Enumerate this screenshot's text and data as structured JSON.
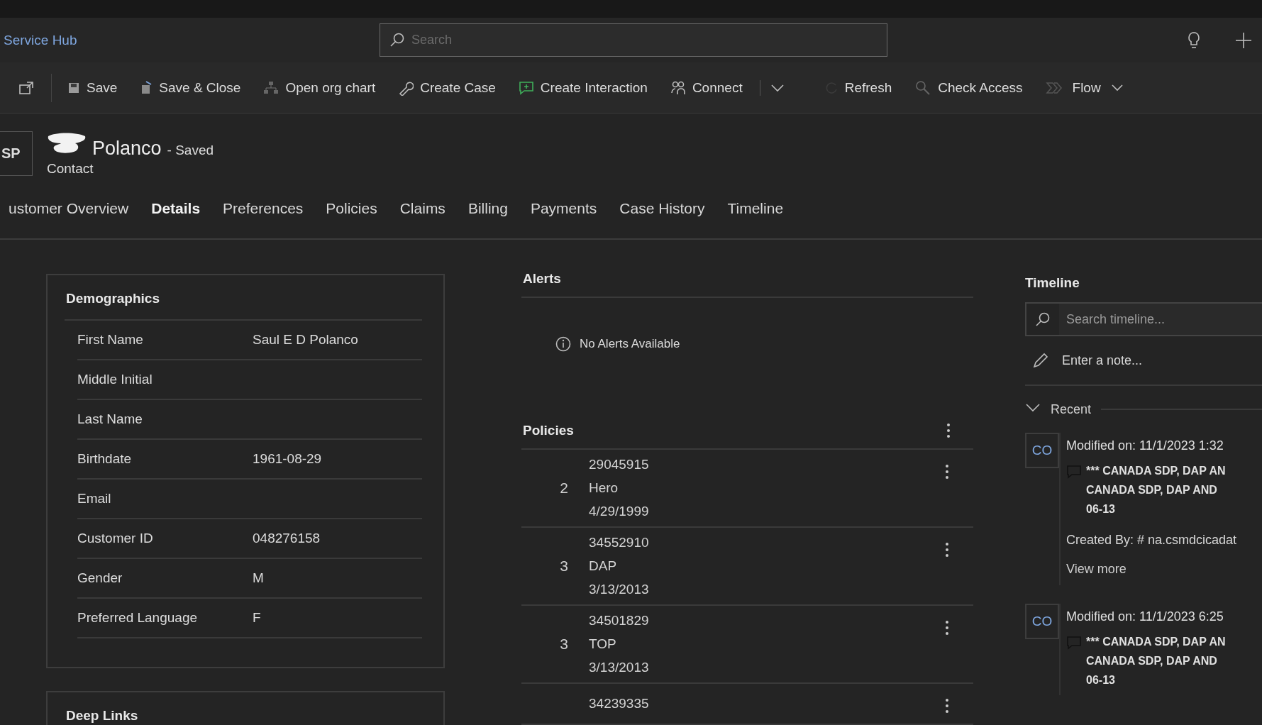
{
  "app": {
    "title": "Service Hub",
    "search_placeholder": "Search"
  },
  "commands": [
    {
      "kind": "icon"
    },
    {
      "kind": "button",
      "label": "Save"
    },
    {
      "kind": "button",
      "label": "Save & Close"
    },
    {
      "kind": "button",
      "label": "Open org chart"
    },
    {
      "kind": "button",
      "label": "Create Case"
    },
    {
      "kind": "button",
      "label": "Create Interaction"
    },
    {
      "kind": "button",
      "label": "Connect"
    },
    {
      "kind": "more"
    },
    {
      "kind": "button",
      "label": "Refresh"
    },
    {
      "kind": "button",
      "label": "Check Access"
    },
    {
      "kind": "button",
      "label": "Flow",
      "caret": true
    }
  ],
  "entity": {
    "avatar": "SP",
    "name": "Polanco",
    "status": "- Saved",
    "type": "Contact"
  },
  "tabs": [
    {
      "label": "ustomer Overview",
      "selected": false
    },
    {
      "label": "Details",
      "selected": true
    },
    {
      "label": "Preferences",
      "selected": false
    },
    {
      "label": "Policies",
      "selected": false
    },
    {
      "label": "Claims",
      "selected": false
    },
    {
      "label": "Billing",
      "selected": false
    },
    {
      "label": "Payments",
      "selected": false
    },
    {
      "label": "Case History",
      "selected": false
    },
    {
      "label": "Timeline",
      "selected": false
    }
  ],
  "demographics": {
    "title": "Demographics",
    "fields": [
      {
        "label": "First Name",
        "value": "Saul E D Polanco"
      },
      {
        "label": "Middle Initial"
      },
      {
        "label": "Last Name"
      },
      {
        "label": "Birthdate",
        "value": "1961-08-29"
      },
      {
        "label": "Email"
      },
      {
        "label": "Customer ID",
        "value": "048276158"
      },
      {
        "label": "Gender",
        "value": "M"
      },
      {
        "label": "Preferred Language",
        "value": "F"
      }
    ]
  },
  "deep_links": {
    "title": "Deep Links"
  },
  "alerts": {
    "title": "Alerts",
    "message": "No Alerts Available"
  },
  "policies": {
    "title": "Policies",
    "rows": [
      {
        "count": "2",
        "number": "29045915",
        "product": "Hero",
        "date": "4/29/1999"
      },
      {
        "count": "3",
        "number": "34552910",
        "product": "DAP",
        "date": "3/13/2013"
      },
      {
        "count": "3",
        "number": "34501829",
        "product": "TOP",
        "date": "3/13/2013"
      },
      {
        "number": "34239335"
      }
    ]
  },
  "timeline": {
    "title": "Timeline",
    "search_placeholder": "Search timeline...",
    "note_placeholder": "Enter a note...",
    "group": {
      "label": "Recent",
      "expanded": true
    },
    "entries": [
      {
        "avatar": "CO",
        "modified": "Modified on: 11/1/2023 1:32",
        "note_lines": [
          "*** CANADA SDP, DAP AN",
          "CANADA SDP, DAP AND",
          "06-13"
        ],
        "created_by": "Created By: # na.csmdcicadat",
        "link": "View more"
      },
      {
        "avatar": "CO",
        "modified": "Modified on: 11/1/2023 6:25",
        "note_lines": [
          "*** CANADA SDP, DAP AN",
          "CANADA SDP, DAP AND",
          "06-13"
        ]
      }
    ]
  }
}
